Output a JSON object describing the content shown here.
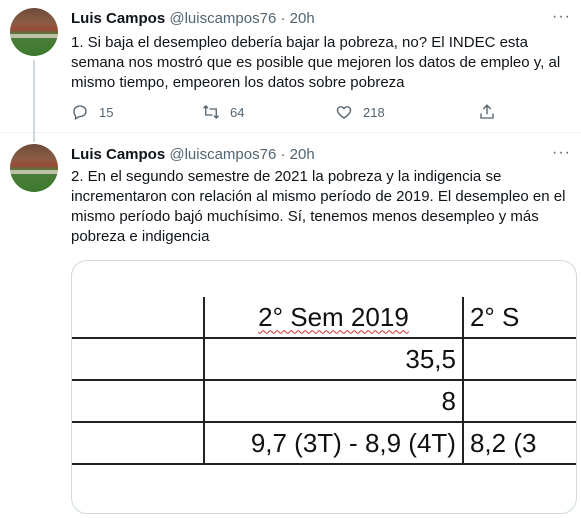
{
  "tweets": [
    {
      "name": "Luis Campos",
      "handle": "@luiscampos76",
      "sep": "·",
      "time": "20h",
      "text": "1. Si baja el desempleo debería bajar la pobreza, no? El INDEC esta semana nos mostró que es posible que mejoren los datos de empleo y, al mismo tiempo, empeoren los datos sobre pobreza",
      "more_icon": "ellipsis-icon",
      "actions": {
        "reply_count": "15",
        "retweet_count": "64",
        "like_count": "218"
      }
    },
    {
      "name": "Luis Campos",
      "handle": "@luiscampos76",
      "sep": "·",
      "time": "20h",
      "text": "2. En el segundo semestre de 2021 la pobreza y la indigencia se incrementaron con relación al mismo período de 2019. El desempleo en el mismo período bajó muchísimo. Sí, tenemos menos desempleo y más pobreza e indigencia",
      "more_icon": "ellipsis-icon"
    }
  ],
  "media_table": {
    "header_col1": "2° Sem 2019",
    "header_col2": "2° S",
    "row1_col1": "35,5",
    "row2_col1": "8",
    "row3_col1": "9,7 (3T) - 8,9 (4T)",
    "row3_col2": "8,2 (3"
  },
  "icons": {
    "reply": "reply-icon",
    "retweet": "retweet-icon",
    "like": "heart-icon",
    "share": "share-icon"
  },
  "colors": {
    "text": "#0f1419",
    "secondary": "#536471",
    "border": "#cfd9de"
  }
}
